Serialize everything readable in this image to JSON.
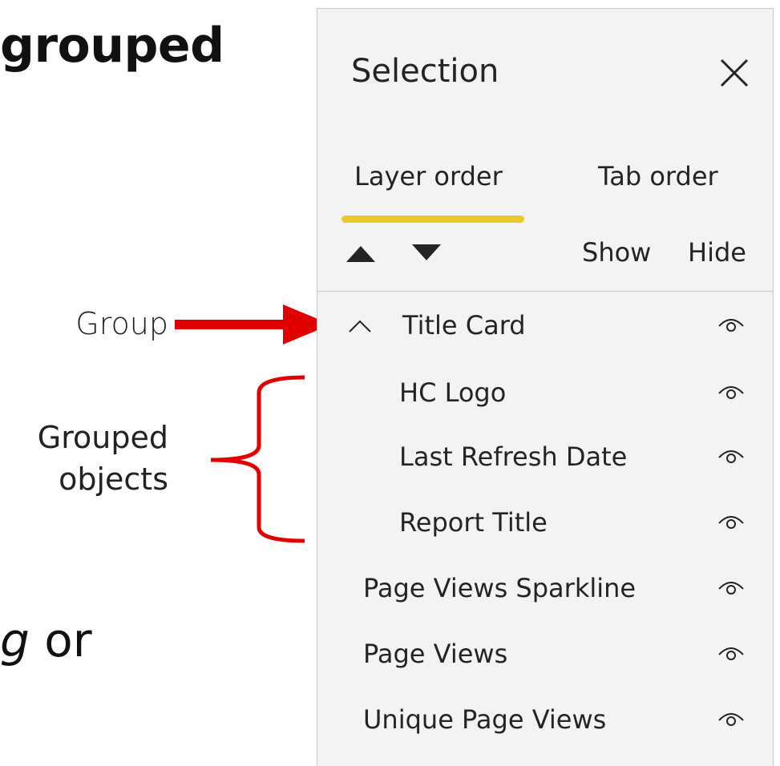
{
  "slide": {
    "heading_fragment": "grouped",
    "body_italic": "g",
    "body_rest": " or",
    "annotation_group": "Group",
    "annotation_grouped_line1": "Grouped",
    "annotation_grouped_line2": "objects",
    "annotation_color": "#e00000"
  },
  "panel": {
    "title": "Selection",
    "close_icon": "close-icon",
    "tabs": [
      {
        "label": "Layer order",
        "active": true
      },
      {
        "label": "Tab order",
        "active": false
      }
    ],
    "active_tab_color": "#e8c92e",
    "toolbar": {
      "move_up_icon": "triangle-up-icon",
      "move_down_icon": "triangle-down-icon",
      "show_label": "Show",
      "hide_label": "Hide"
    },
    "layers": [
      {
        "label": "Title Card",
        "type": "group",
        "expanded": true,
        "visible": true
      },
      {
        "label": "HC Logo",
        "type": "child",
        "visible": true
      },
      {
        "label": "Last Refresh Date",
        "type": "child",
        "visible": true
      },
      {
        "label": "Report Title",
        "type": "child",
        "visible": true
      },
      {
        "label": "Page Views Sparkline",
        "type": "item",
        "visible": true
      },
      {
        "label": "Page Views",
        "type": "item",
        "visible": true
      },
      {
        "label": "Unique Page Views",
        "type": "item",
        "visible": true
      }
    ]
  }
}
